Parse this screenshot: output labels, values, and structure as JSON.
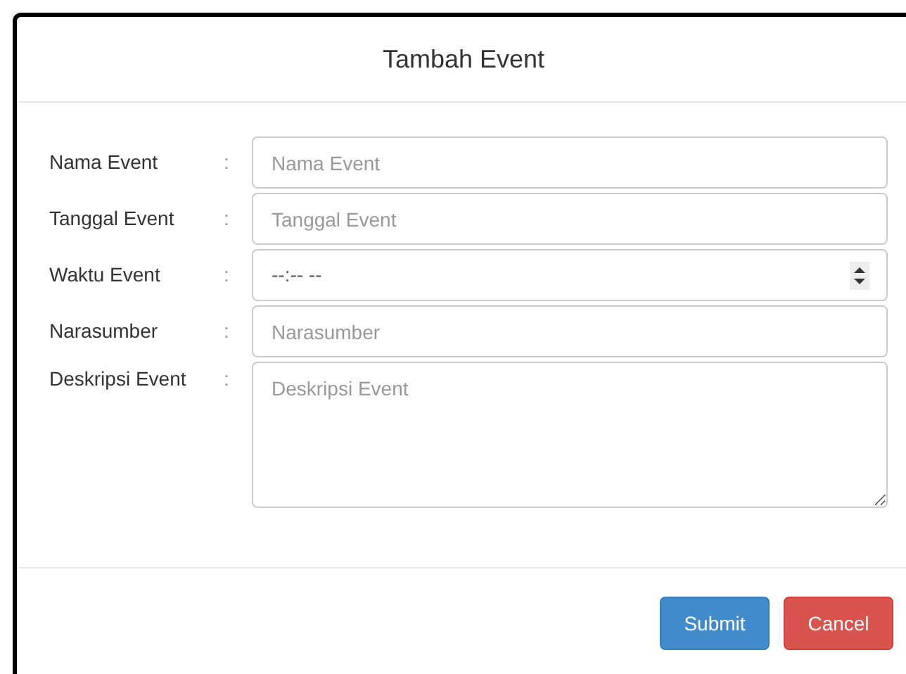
{
  "modal": {
    "title": "Tambah Event"
  },
  "fields": [
    {
      "kind": "text",
      "label": "Nama Event",
      "separator": ":",
      "placeholder": "Nama Event"
    },
    {
      "kind": "text",
      "label": "Tanggal Event",
      "separator": ":",
      "placeholder": "Tanggal Event"
    },
    {
      "kind": "time",
      "label": "Waktu Event",
      "separator": ":",
      "value": "--:-- --"
    },
    {
      "kind": "text",
      "label": "Narasumber",
      "separator": ":",
      "placeholder": "Narasumber"
    },
    {
      "kind": "textarea",
      "label": "Deskripsi Event",
      "separator": ":",
      "placeholder": "Deskripsi Event"
    }
  ],
  "buttons": [
    {
      "kind": "primary",
      "label": "Submit"
    },
    {
      "kind": "danger",
      "label": "Cancel"
    }
  ]
}
